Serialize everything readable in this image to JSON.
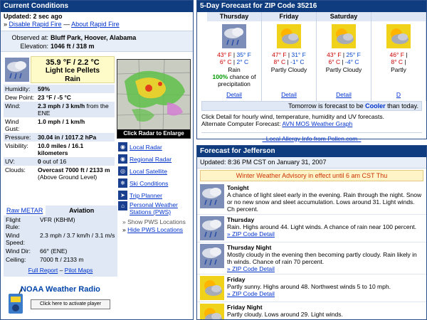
{
  "current": {
    "header": "Current Conditions",
    "updated_label": "Updated:",
    "updated": "2 sec ago",
    "disable_link": "Disable Rapid Fire",
    "sep": "—",
    "about_link": "About Rapid Fire",
    "observed_label": "Observed at:",
    "observed": "Bluff Park, Hoover, Alabama",
    "elevation_label": "Elevation:",
    "elevation": "1046 ft / 318 m",
    "temp": "35.9 °F / 2.2 °C",
    "condition": "Light Ice Pellets",
    "condition2": "Rain",
    "rows": [
      {
        "k": "Humidity:",
        "v": "59%",
        "s": ""
      },
      {
        "k": "Dew Point:",
        "v": "23 °F / -5 °C",
        "s": ""
      },
      {
        "k": "Wind:",
        "v": "2.3 mph / 3 km/h",
        "s": " from the ENE"
      },
      {
        "k": "Wind Gust:",
        "v": "1.0 mph / 1 km/h",
        "s": ""
      },
      {
        "k": "Pressure:",
        "v": "30.04 in / 1017.2 hPa",
        "s": ""
      },
      {
        "k": "Visibility:",
        "v": "10.0 miles / 16.1 kilometers",
        "s": ""
      },
      {
        "k": "UV:",
        "v": "0",
        "s": " out of 16"
      },
      {
        "k": "Clouds:",
        "v": "Overcast 7000 ft / 2133 m",
        "s": " (Above Ground Level)"
      }
    ]
  },
  "radar": {
    "caption": "Click Radar to Enlarge",
    "links": [
      "Local Radar",
      "Regional Radar",
      "Local Satellite",
      "Ski Conditions",
      "Trip Planner",
      "Personal Weather Stations (PWS)"
    ],
    "show_label": "Show PWS Locations",
    "hide_label": "Hide PWS Locations"
  },
  "metar": {
    "tab_raw": "Raw METAR",
    "tab_aviation": "Aviation",
    "rows": [
      {
        "k": "Flight Rule:",
        "v": "VFR (KBHM)"
      },
      {
        "k": "Wind Speed:",
        "v": "2.3 mph / 3.7 km/h / 3.1 m/s"
      },
      {
        "k": "Wind Dir:",
        "v": "66° (ENE)"
      },
      {
        "k": "Ceiling:",
        "v": "7000 ft / 2133 m"
      }
    ],
    "full_report": "Full Report",
    "pilot_maps": "Pilot Maps"
  },
  "noaa": {
    "title": "NOAA Weather Radio",
    "button": "Click here to activate player"
  },
  "forecast5": {
    "header": "5-Day Forecast for ZIP Code 35216",
    "days": [
      {
        "name": "Thursday",
        "hi": "43° F",
        "lo": "35° F",
        "hi_c": "6° C",
        "lo_c": "2° C",
        "desc": "Rain",
        "pct": "100%",
        "pct_text": " chance of precipitation",
        "detail": "Detail"
      },
      {
        "name": "Friday",
        "hi": "47° F",
        "lo": "31° F",
        "hi_c": "8° C",
        "lo_c": "-1° C",
        "desc": "Partly Cloudy",
        "pct": "",
        "pct_text": "",
        "detail": "Detail"
      },
      {
        "name": "Saturday",
        "hi": "43° F",
        "lo": "25° F",
        "hi_c": "6° C",
        "lo_c": "-4° C",
        "desc": "Partly Cloudy",
        "pct": "",
        "pct_text": "",
        "detail": "Detail"
      },
      {
        "name": "",
        "hi": "46° F",
        "lo": "",
        "hi_c": "8° C",
        "lo_c": "",
        "desc": "Partly",
        "pct": "",
        "pct_text": "",
        "detail": "D"
      }
    ],
    "tomorrow_pre": "Tomorrow is forecast to be ",
    "tomorrow_word": "Cooler",
    "tomorrow_post": " than today.",
    "note1": "Click Detail for hourly wind, temperature, humidity and UV forecasts.",
    "note2_label": "Alternate Computer Forecast: ",
    "note2_link": "AVN MOS Weather Graph",
    "allergy": "- Local Allergy Info from Pollen.com -"
  },
  "jefferson": {
    "header": "Forecast for Jefferson",
    "updated": "Updated: 8:36 PM CST on January 31, 2007",
    "advisory": "Winter Weather Advisory in effect until 6 am CST Thu",
    "zip_link": "» ZIP Code Detail",
    "periods": [
      {
        "name": "Tonight",
        "text": "A chance of light sleet early in the evening. Rain through the night. Snow or no new snow and sleet accumulation. Lows around 31. Light winds. Ch percent."
      },
      {
        "name": "Thursday",
        "text": "Rain. Highs around 44. Light winds. A chance of rain near 100 percent."
      },
      {
        "name": "Thursday Night",
        "text": "Mostly cloudy in the evening then becoming partly cloudy. Rain likely in th winds. Chance of rain 70 percent."
      },
      {
        "name": "Friday",
        "text": "Partly sunny. Highs around 48. Northwest winds 5 to 10 mph."
      },
      {
        "name": "Friday Night",
        "text": "Partly cloudy. Lows around 29. Light winds."
      }
    ]
  },
  "colors": {
    "header_bg": "#0f3c7e",
    "link": "#0033cc",
    "hi_temp": "#cc0000",
    "lo_temp": "#0044cc",
    "panel": "#dfe8f4"
  }
}
